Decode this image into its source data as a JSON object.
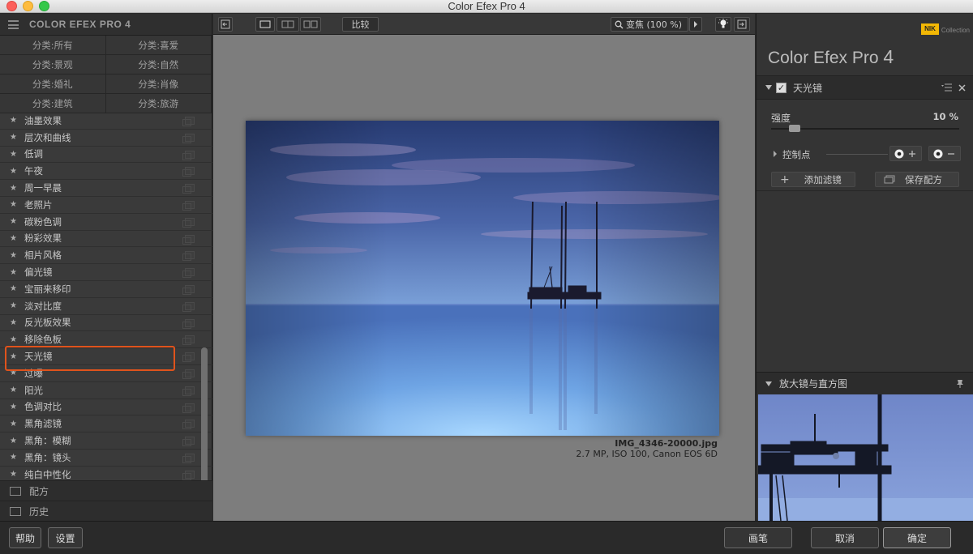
{
  "window": {
    "title": "Color Efex Pro 4"
  },
  "left_panel": {
    "app_title": "COLOR EFEX PRO 4",
    "categories": [
      "分类:所有",
      "分类:喜爱",
      "分类:景观",
      "分类:自然",
      "分类:婚礼",
      "分类:肖像",
      "分类:建筑",
      "分类:旅游"
    ],
    "filters": [
      "油墨效果",
      "层次和曲线",
      "低调",
      "午夜",
      "周一早晨",
      "老照片",
      "碳粉色调",
      "粉彩效果",
      "相片风格",
      "偏光镜",
      "宝丽来移印",
      "淡对比度",
      "反光板效果",
      "移除色板",
      "天光镜",
      "过曝",
      "阳光",
      "色调对比",
      "黑角滤镜",
      "黑角：模糊",
      "黑角：镜头",
      "纯白中性化"
    ],
    "highlighted_filter": "天光镜",
    "section_recipes": "配方",
    "section_history": "历史"
  },
  "toolbar": {
    "compare_label": "比较",
    "zoom_label": "变焦 (100 %)"
  },
  "preview": {
    "filename": "IMG_4346-20000.jpg",
    "info": "2.7 MP, ISO 100, Canon EOS 6D"
  },
  "right_panel": {
    "logo": "NIK",
    "logo_sub": "Collection",
    "title_main": "Color Efex Pro",
    "title_num": "4",
    "filter_name": "天光镜",
    "strength_label": "强度",
    "strength_value": "10 %",
    "strength_fraction": 0.1,
    "control_points_label": "控制点",
    "add_filter_label": "添加滤镜",
    "save_recipe_label": "保存配方",
    "loupe_label": "放大镜与直方图"
  },
  "bottom_bar": {
    "help_label": "帮助",
    "settings_label": "设置",
    "brush_label": "画笔",
    "cancel_label": "取消",
    "ok_label": "确定"
  },
  "colors": {
    "highlight_border": "#e0531c",
    "nik_yellow": "#f2b705"
  }
}
